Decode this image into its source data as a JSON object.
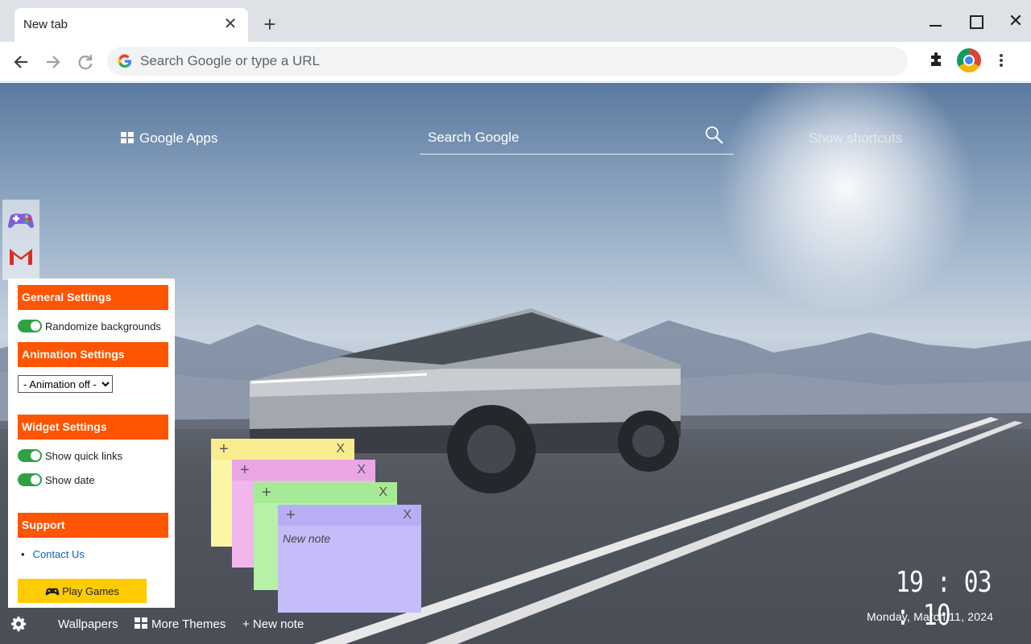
{
  "browser": {
    "tab_title": "New tab",
    "tab_close": "✕",
    "new_tab": "+",
    "close_window": "✕",
    "omnibox_placeholder": "Search Google or type a URL"
  },
  "newtab": {
    "google_apps": "Google Apps",
    "search_placeholder": "Search Google",
    "show_shortcuts": "Show shortcuts"
  },
  "settings": {
    "general_title": "General Settings",
    "randomize_backgrounds": "Randomize backgrounds",
    "animation_title": "Animation Settings",
    "animation_selected": "- Animation off -",
    "widget_title": "Widget Settings",
    "show_quick_links": "Show quick links",
    "show_date": "Show date",
    "support_title": "Support",
    "contact_us": "Contact Us",
    "play_games": "Play Games"
  },
  "notes": [
    {
      "color": "#fdf5a6",
      "add": "+",
      "close": "X",
      "text": ""
    },
    {
      "color": "#f1b6ec",
      "add": "+",
      "close": "X",
      "text": ""
    },
    {
      "color": "#b7f1a8",
      "add": "+",
      "close": "X",
      "text": ""
    },
    {
      "color": "#c5bdfa",
      "add": "+",
      "close": "X",
      "text": "New note"
    }
  ],
  "footer": {
    "wallpapers": "Wallpapers",
    "more_themes": "More Themes",
    "new_note": "+ New note"
  },
  "clock": {
    "time": "19 : 03 : 10",
    "date": "Monday, March 11, 2024"
  },
  "colors": {
    "accent": "#ff5400",
    "toggle_on": "#2ea143",
    "play_button": "#ffcc00"
  }
}
